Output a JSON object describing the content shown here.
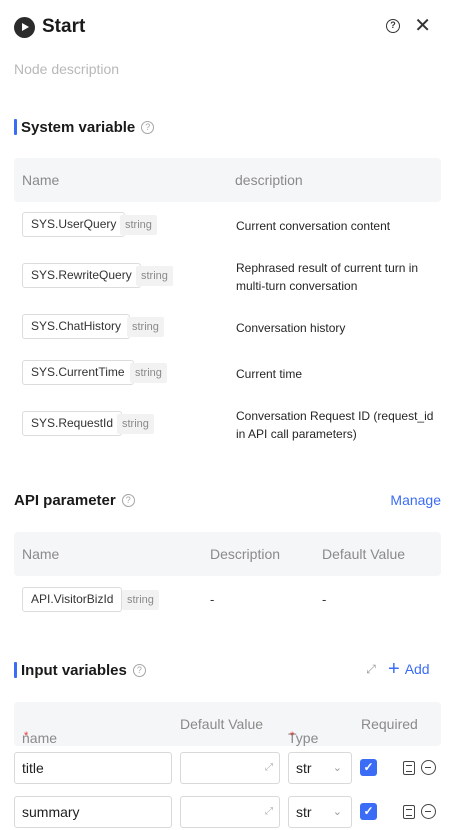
{
  "header": {
    "title": "Start"
  },
  "node_description_placeholder": "Node description",
  "system_variable": {
    "title": "System variable",
    "columns": [
      "Name",
      "description"
    ],
    "rows": [
      {
        "name": "SYS.UserQuery",
        "type": "string",
        "description": "Current conversation content"
      },
      {
        "name": "SYS.RewriteQuery",
        "type": "string",
        "description": "Rephrased result of current turn in multi-turn conversation"
      },
      {
        "name": "SYS.ChatHistory",
        "type": "string",
        "description": "Conversation history"
      },
      {
        "name": "SYS.CurrentTime",
        "type": "string",
        "description": "Current time"
      },
      {
        "name": "SYS.RequestId",
        "type": "string",
        "description": "Conversation Request ID (request_id in API call parameters)"
      }
    ]
  },
  "api_parameter": {
    "title": "API parameter",
    "manage_label": "Manage",
    "columns": [
      "Name",
      "Description",
      "Default Value"
    ],
    "rows": [
      {
        "name": "API.VisitorBizId",
        "type": "string",
        "description": "-",
        "default": "-"
      }
    ]
  },
  "input_variables": {
    "title": "Input variables",
    "add_label": "Add",
    "columns": {
      "name": "name",
      "default": "Default Value",
      "type": "Type",
      "required": "Required"
    },
    "rows": [
      {
        "name": "title",
        "default": "",
        "type": "str",
        "required": true
      },
      {
        "name": "summary",
        "default": "",
        "type": "str",
        "required": true
      }
    ]
  },
  "colors": {
    "accent": "#3b6cf6",
    "required_star": "#e53935"
  }
}
